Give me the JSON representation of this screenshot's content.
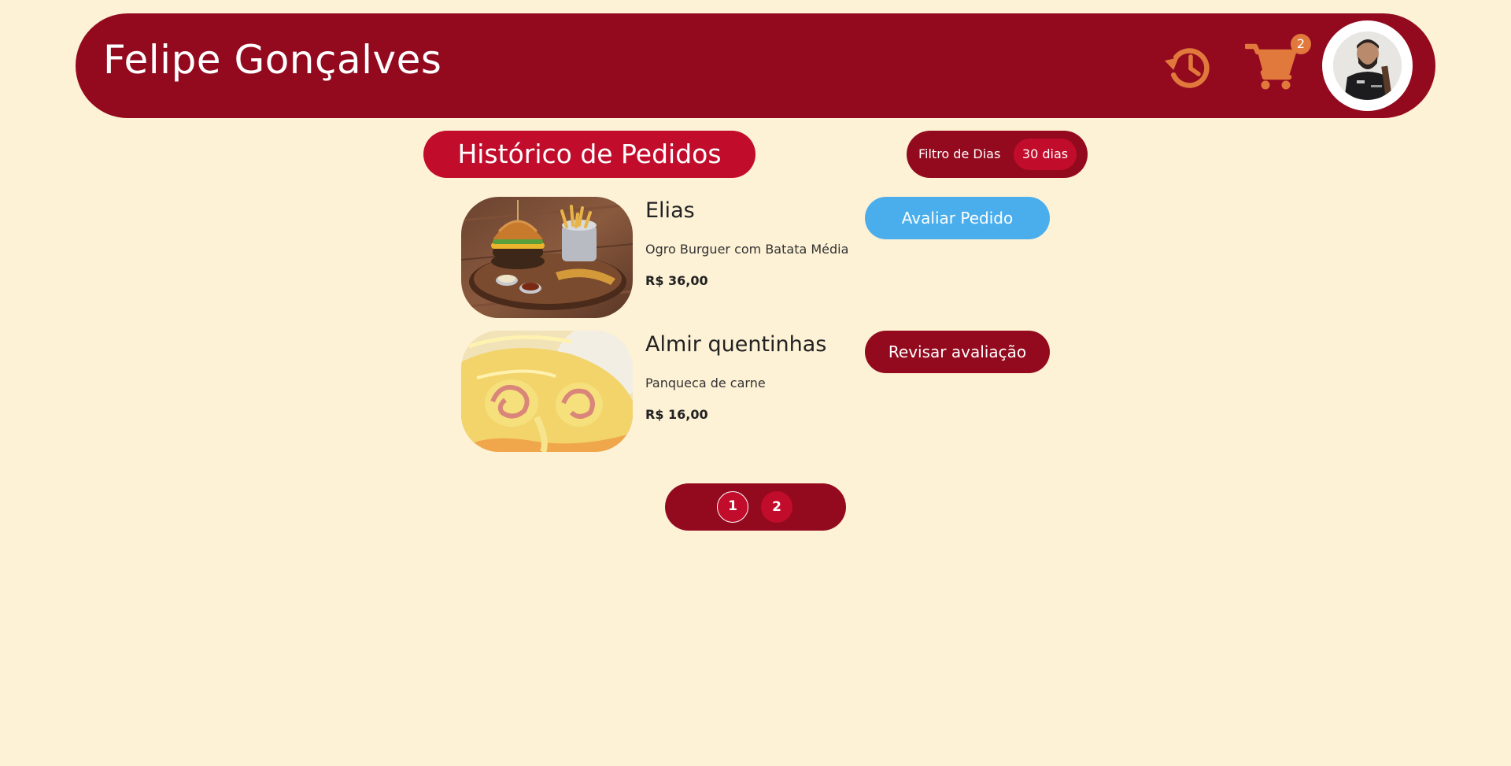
{
  "header": {
    "user_name": "Felipe Gonçalves",
    "history_icon": "history-icon",
    "cart_icon": "cart-icon",
    "cart_count": "2",
    "avatar": "user-avatar"
  },
  "page": {
    "title": "Histórico de Pedidos",
    "filter_label": "Filtro de Dias",
    "filter_value": "30 dias"
  },
  "orders": [
    {
      "restaurant": "Elias",
      "dish": "Ogro Burguer com Batata Média",
      "price": "R$ 36,00",
      "action": "Avaliar Pedido"
    },
    {
      "restaurant": "Almir quentinhas",
      "dish": "Panqueca de carne",
      "price": "R$ 16,00",
      "action": "Revisar avaliação"
    }
  ],
  "pagination": {
    "pages": [
      "1",
      "2"
    ],
    "current": "1"
  },
  "colors": {
    "background": "#fdf1d6",
    "primary": "#930a1f",
    "accent": "#c20c2b",
    "icon": "#e2793c",
    "rate_button": "#4aaeed"
  }
}
